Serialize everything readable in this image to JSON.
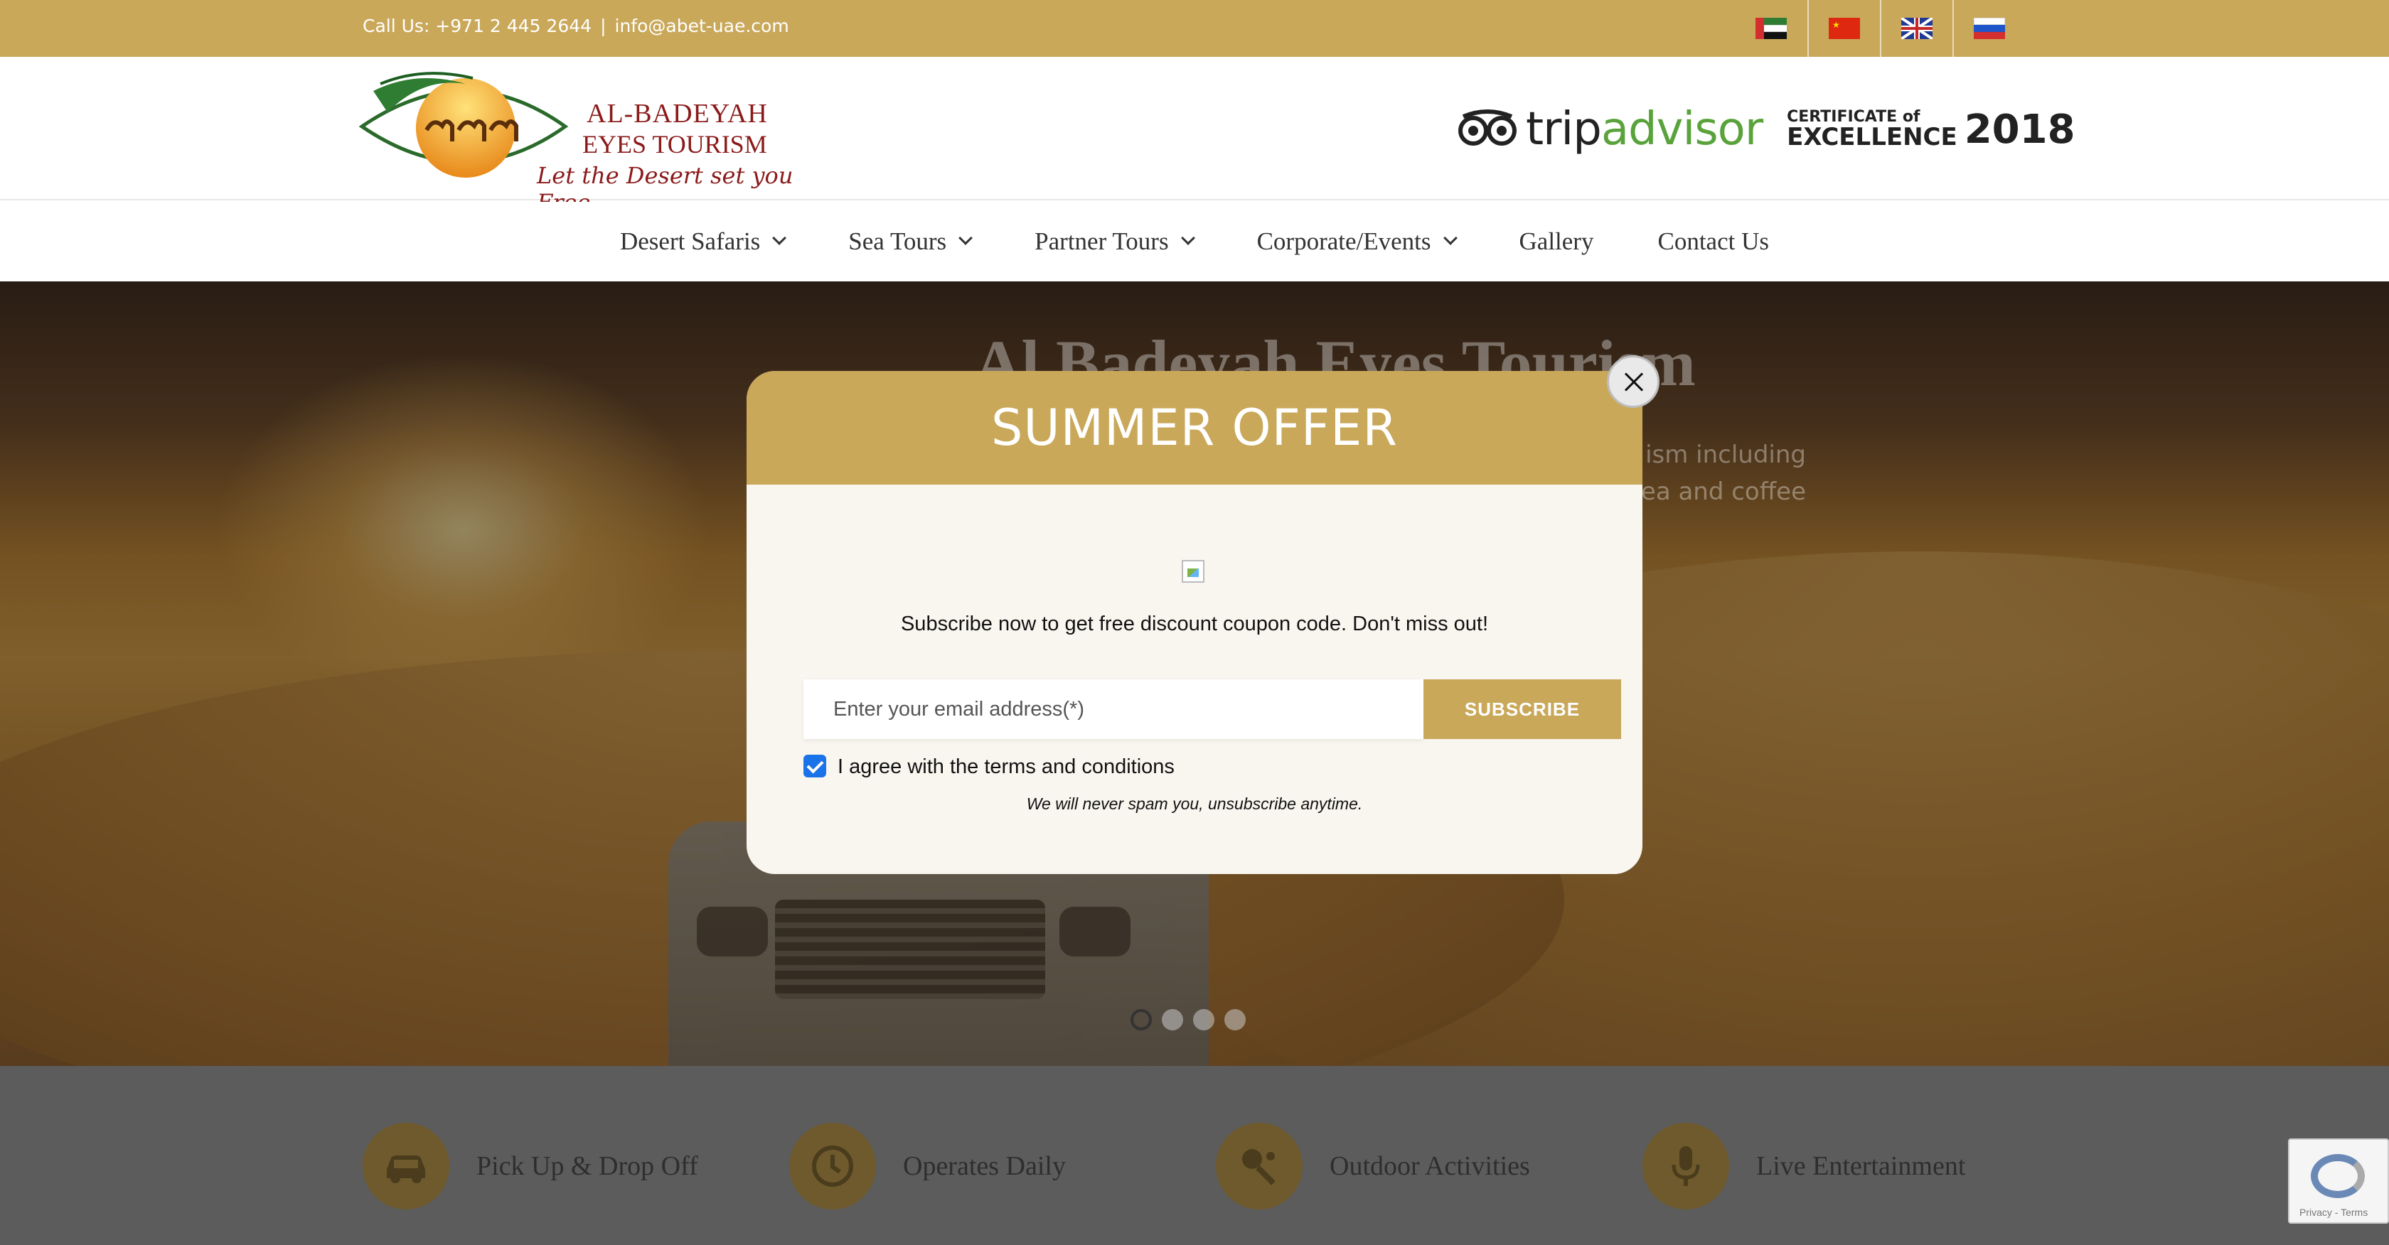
{
  "topbar": {
    "contact_phone": "Call Us: +971 2 445 2644",
    "separator": "|",
    "contact_email": "info@abet-uae.com",
    "flags": [
      "uae-flag-icon",
      "china-flag-icon",
      "uk-flag-icon",
      "russia-flag-icon"
    ]
  },
  "header": {
    "logo_line1": "AL-BADEYAH",
    "logo_line2": "EYES TOURISM",
    "logo_tagline": "Let the Desert set you Free",
    "tripadvisor_trip": "trip",
    "tripadvisor_advisor": "advisor",
    "cert_line1": "CERTIFICATE of",
    "cert_line2": "EXCELLENCE",
    "cert_year": "2018"
  },
  "nav": {
    "items": [
      {
        "label": "Desert Safaris",
        "dropdown": true
      },
      {
        "label": "Sea Tours",
        "dropdown": true
      },
      {
        "label": "Partner Tours",
        "dropdown": true
      },
      {
        "label": "Corporate/Events",
        "dropdown": true
      },
      {
        "label": "Gallery",
        "dropdown": false
      },
      {
        "label": "Contact Us",
        "dropdown": false
      }
    ]
  },
  "hero": {
    "title": "Al Badeyah Eyes Tourism",
    "subtitle_line1": "ism including",
    "subtitle_line2": "ea and coffee",
    "slides": 4,
    "active_slide": 1
  },
  "features": {
    "items": [
      {
        "label": "Pick Up & Drop Off",
        "icon": "car-icon"
      },
      {
        "label": "Operates Daily",
        "icon": "clock-icon"
      },
      {
        "label": "Outdoor Activities",
        "icon": "activities-icon"
      },
      {
        "label": "Live Entertainment",
        "icon": "microphone-icon"
      }
    ]
  },
  "recaptcha": {
    "text": "Privacy - Terms"
  },
  "modal": {
    "title": "SUMMER OFFER",
    "message": "Subscribe now to get free discount coupon code. Don't miss out!",
    "email_placeholder": "Enter your email address(*)",
    "subscribe_label": "SUBSCRIBE",
    "agree_label": "I agree with the terms and conditions",
    "agree_checked": true,
    "spam_note": "We will never spam you, unsubscribe anytime."
  },
  "colors": {
    "accent_gold": "#c9a85a",
    "logo_red": "#8b1a1a",
    "tripadvisor_green": "#5aa33c",
    "checkbox_blue": "#1a73e8"
  }
}
